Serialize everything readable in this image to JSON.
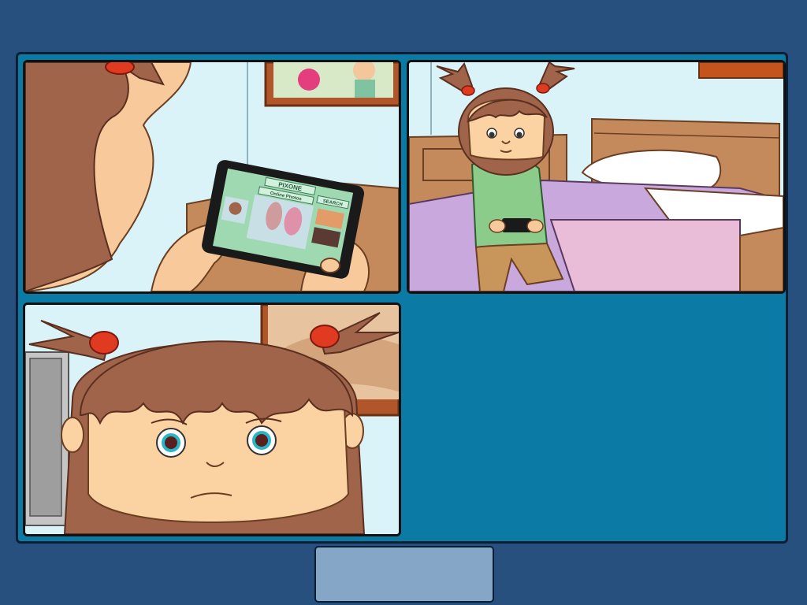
{
  "scene": {
    "panels": [
      {
        "id": "panel-1",
        "description_label": "girl looking at tablet"
      },
      {
        "id": "panel-2",
        "description_label": "girl sitting on bed with phone"
      },
      {
        "id": "panel-3",
        "description_label": "girl worried face"
      }
    ],
    "tablet_screen": {
      "app_title": "PIXONE",
      "album_title": "Online Photos",
      "search_label": "SEARCH"
    }
  },
  "controls": {
    "next_button_label": ""
  },
  "colors": {
    "background": "#27507e",
    "frame": "#0b7aa5",
    "button": "#86a6c8",
    "hair": "#9c6048",
    "skin": "#fbd3a3",
    "shirt": "#8bcc8b",
    "bedspread": "#c9a8de"
  }
}
